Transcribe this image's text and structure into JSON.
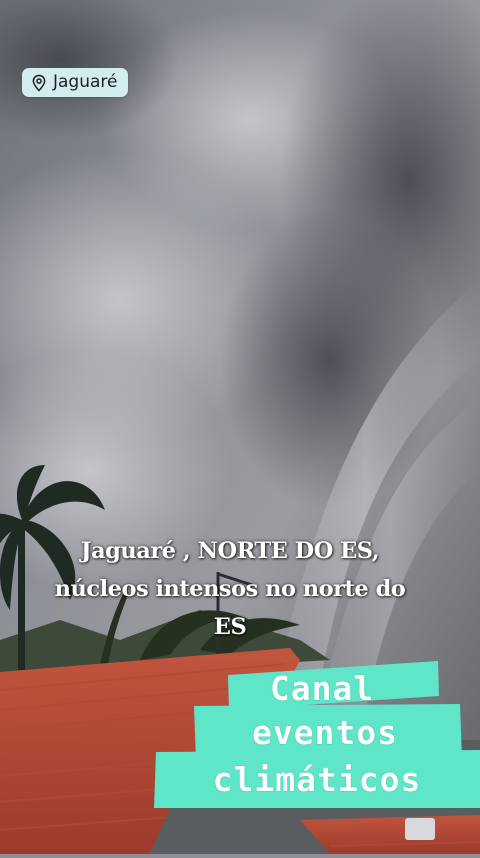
{
  "location_tag": {
    "text": "Jaguaré",
    "icon": "map-pin-icon",
    "background": "#d3ecef"
  },
  "caption": {
    "lines": [
      "Jaguaré , NORTE DO ES,",
      "núcleos intensos no norte do",
      "ES"
    ]
  },
  "banner": {
    "lines": [
      "Canal",
      "eventos",
      "climáticos"
    ],
    "color": "#5fe6c8"
  }
}
